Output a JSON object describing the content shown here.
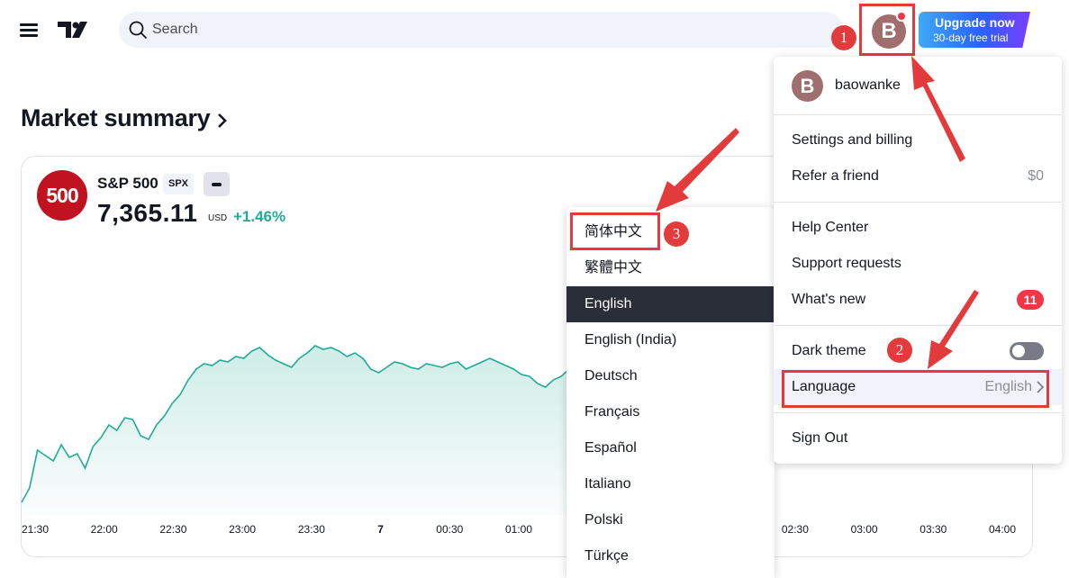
{
  "header": {
    "menu_icon": "hamburger-icon",
    "logo_icon": "tradingview-logo",
    "search": {
      "placeholder": "Search",
      "value": ""
    },
    "avatar_initial": "B",
    "upgrade": {
      "title": "Upgrade now",
      "subtitle": "30-day free trial"
    }
  },
  "market_summary": {
    "title": "Market summary",
    "symbol": {
      "logo_text": "500",
      "name": "S&P 500",
      "ticker": "SPX",
      "price": "7,365.11",
      "currency": "USD",
      "change": "+1.46%"
    }
  },
  "chart_data": {
    "type": "area",
    "x_tick_labels": [
      "21:30",
      "22:00",
      "22:30",
      "23:00",
      "23:30",
      "7",
      "00:30",
      "01:00",
      "",
      "",
      "",
      "02:30",
      "03:00",
      "03:30",
      "04:00"
    ],
    "series": [
      {
        "values": [
          0.06,
          0.14,
          0.35,
          0.32,
          0.29,
          0.38,
          0.31,
          0.33,
          0.25,
          0.37,
          0.42,
          0.49,
          0.46,
          0.53,
          0.52,
          0.43,
          0.41,
          0.49,
          0.54,
          0.61,
          0.66,
          0.74,
          0.8,
          0.83,
          0.82,
          0.85,
          0.84,
          0.87,
          0.86,
          0.9,
          0.92,
          0.88,
          0.85,
          0.83,
          0.81,
          0.86,
          0.89,
          0.93,
          0.91,
          0.92,
          0.9,
          0.87,
          0.89,
          0.86,
          0.8,
          0.78,
          0.81,
          0.84,
          0.83,
          0.81,
          0.8,
          0.83,
          0.82,
          0.81,
          0.83,
          0.84,
          0.8,
          0.82,
          0.84,
          0.86,
          0.84,
          0.82,
          0.8,
          0.77,
          0.76,
          0.72,
          0.7,
          0.74,
          0.76,
          0.8
        ]
      }
    ],
    "line_color": "#22ab94",
    "fill_color": "#22ab94"
  },
  "language_menu": {
    "items": [
      {
        "label": "简体中文",
        "active": false
      },
      {
        "label": "繁體中文",
        "active": false
      },
      {
        "label": "English",
        "active": true
      },
      {
        "label": "English (India)",
        "active": false
      },
      {
        "label": "Deutsch",
        "active": false
      },
      {
        "label": "Français",
        "active": false
      },
      {
        "label": "Español",
        "active": false
      },
      {
        "label": "Italiano",
        "active": false
      },
      {
        "label": "Polski",
        "active": false
      },
      {
        "label": "Türkçe",
        "active": false
      }
    ]
  },
  "user_menu": {
    "avatar_initial": "B",
    "username": "baowanke",
    "settings": "Settings and billing",
    "refer": "Refer a friend",
    "refer_value": "$0",
    "help": "Help Center",
    "support": "Support requests",
    "whats_new": "What's new",
    "whats_new_badge": "11",
    "dark_theme": "Dark theme",
    "dark_theme_on": false,
    "language": "Language",
    "language_value": "English",
    "sign_out": "Sign Out"
  },
  "annotations": {
    "step1": "1",
    "step2": "2",
    "step3": "3"
  },
  "colors": {
    "accent_red": "#e33b3b",
    "brand_blue": "#2962ff",
    "positive": "#22ab94"
  }
}
